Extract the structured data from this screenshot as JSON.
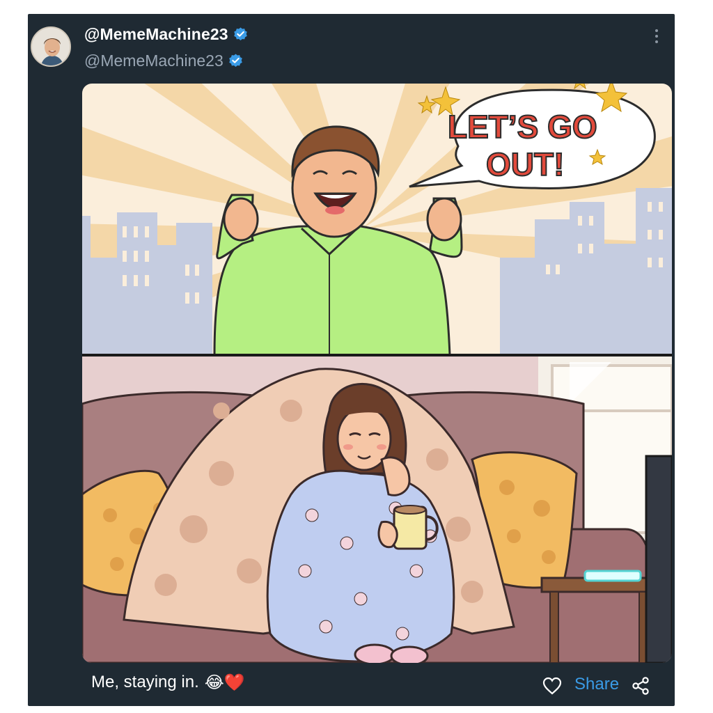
{
  "post": {
    "display_name": "@MemeMachine23",
    "handle": "@MemeMachine23",
    "caption": "Me, staying in.",
    "caption_emoji": "😂❤️",
    "share_label": "Share"
  },
  "meme": {
    "top_panel_speech_line1": "LET’S GO",
    "top_panel_speech_line2": "OUT!"
  },
  "icons": {
    "verified": "verified-badge-icon",
    "more": "more-vertical-icon",
    "like": "heart-outline-icon",
    "share": "share-nodes-icon"
  },
  "colors": {
    "card_bg": "#1f2a33",
    "verified_blue": "#3a9be6",
    "share_blue": "#3a9be6",
    "handle_gray": "#9aa7b5"
  }
}
